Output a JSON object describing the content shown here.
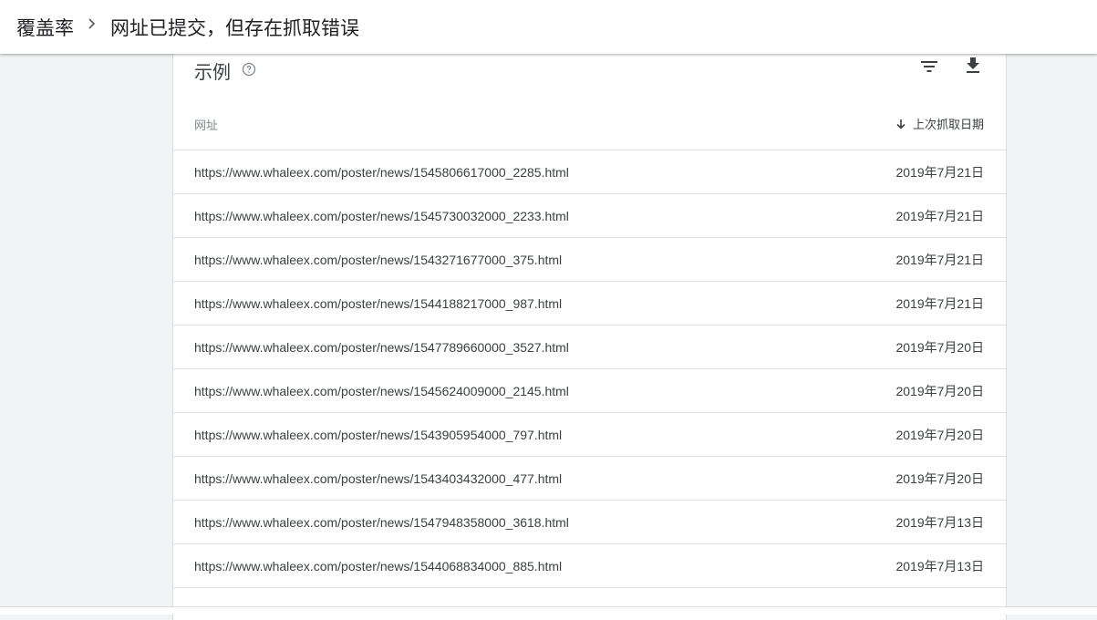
{
  "breadcrumb": {
    "root": "覆盖率",
    "separator_icon": "chevron-right-icon",
    "current": "网址已提交，但存在抓取错误"
  },
  "card": {
    "title": "示例",
    "help_icon": "help-circle-icon",
    "filter_icon": "filter-icon",
    "download_icon": "download-icon"
  },
  "table": {
    "columns": {
      "url": "网址",
      "date": "上次抓取日期",
      "sort_icon": "arrow-down-icon"
    },
    "rows": [
      {
        "url": "https://www.whaleex.com/poster/news/1545806617000_2285.html",
        "date": "2019年7月21日"
      },
      {
        "url": "https://www.whaleex.com/poster/news/1545730032000_2233.html",
        "date": "2019年7月21日"
      },
      {
        "url": "https://www.whaleex.com/poster/news/1543271677000_375.html",
        "date": "2019年7月21日"
      },
      {
        "url": "https://www.whaleex.com/poster/news/1544188217000_987.html",
        "date": "2019年7月21日"
      },
      {
        "url": "https://www.whaleex.com/poster/news/1547789660000_3527.html",
        "date": "2019年7月20日"
      },
      {
        "url": "https://www.whaleex.com/poster/news/1545624009000_2145.html",
        "date": "2019年7月20日"
      },
      {
        "url": "https://www.whaleex.com/poster/news/1543905954000_797.html",
        "date": "2019年7月20日"
      },
      {
        "url": "https://www.whaleex.com/poster/news/1543403432000_477.html",
        "date": "2019年7月20日"
      },
      {
        "url": "https://www.whaleex.com/poster/news/1547948358000_3618.html",
        "date": "2019年7月13日"
      },
      {
        "url": "https://www.whaleex.com/poster/news/1544068834000_885.html",
        "date": "2019年7月13日"
      }
    ]
  }
}
